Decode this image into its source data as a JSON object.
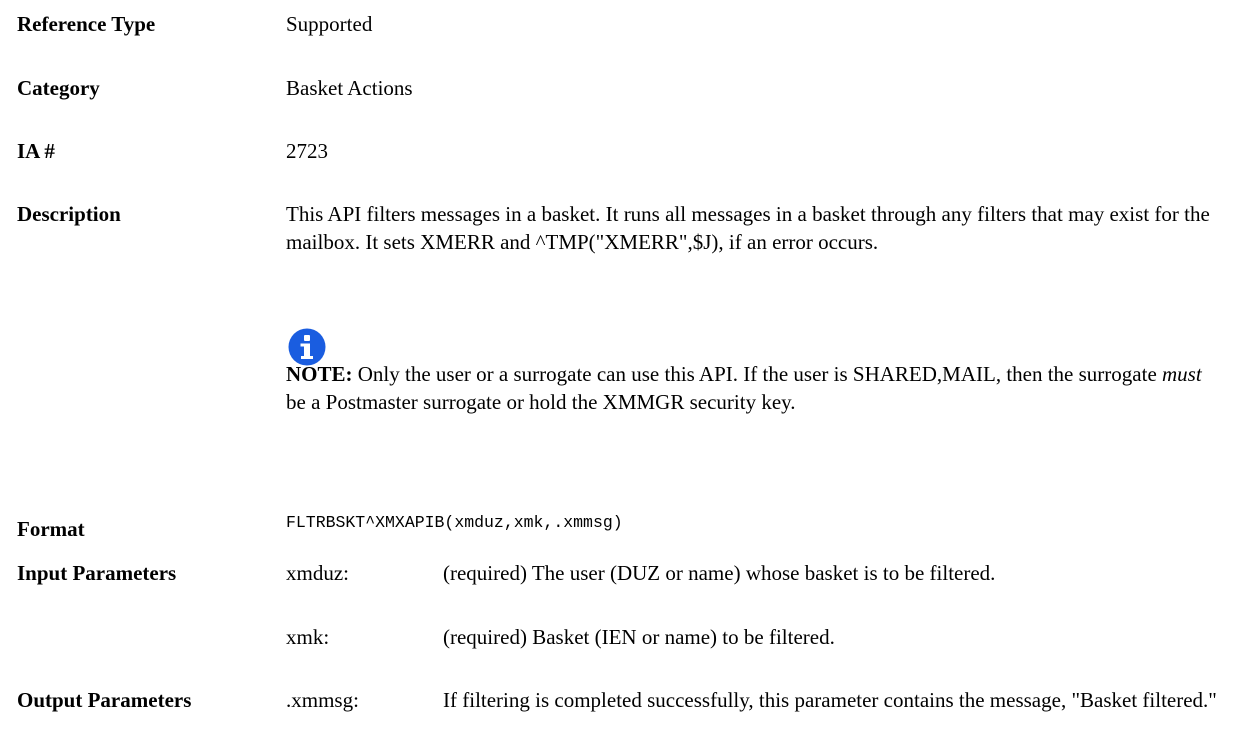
{
  "reference_type": {
    "label": "Reference Type",
    "value": "Supported"
  },
  "category": {
    "label": "Category",
    "value": "Basket Actions"
  },
  "ia": {
    "label": "IA #",
    "value": "2723"
  },
  "description": {
    "label": "Description",
    "text": "This API filters messages in a basket. It runs all messages in a basket through any filters that may exist for the mailbox. It sets XMERR and ^TMP(\"XMERR\",$J), if an error occurs.",
    "note": {
      "icon": "info-icon",
      "icon_color": "#1a5de0",
      "label": "NOTE:",
      "text_before": " Only the user or a surrogate can use this API. If the user is SHARED,MAIL, then the surrogate ",
      "emphasis": "must",
      "text_after": " be a Postmaster surrogate or hold the XMMGR security key."
    }
  },
  "format": {
    "label": "Format",
    "value": "FLTRBSKT^XMXAPIB(xmduz,xmk,.xmmsg)"
  },
  "input_parameters": {
    "label": "Input Parameters",
    "items": [
      {
        "name": "xmduz:",
        "desc": "(required) The user (DUZ or name) whose basket is to be filtered."
      },
      {
        "name": "xmk:",
        "desc": "(required) Basket (IEN or name) to be filtered."
      }
    ]
  },
  "output_parameters": {
    "label": "Output Parameters",
    "items": [
      {
        "name": ".xmmsg:",
        "desc": "If filtering is completed successfully, this parameter contains the message, \"Basket filtered.\""
      }
    ]
  }
}
